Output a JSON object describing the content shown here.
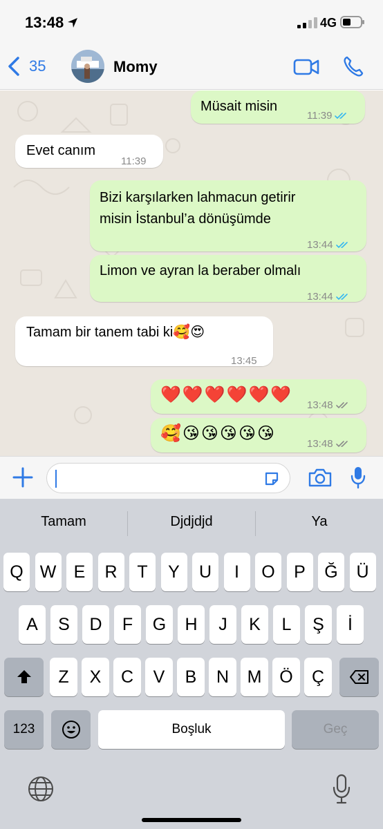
{
  "status_bar": {
    "time": "13:48",
    "network": "4G"
  },
  "header": {
    "back_count": "35",
    "contact_name": "Momy"
  },
  "messages": [
    {
      "direction": "out",
      "text": "Müsait misin",
      "time": "11:39",
      "read": true
    },
    {
      "direction": "in",
      "text": "Evet canım",
      "time": "11:39"
    },
    {
      "direction": "out",
      "text": "Bizi karşılarken lahmacun getirir misin İstanbul’a dönüşümde",
      "line1": "Bizi karşılarken lahmacun getirir",
      "line2": "misin İstanbul’a dönüşümde",
      "time": "13:44",
      "read": true
    },
    {
      "direction": "out",
      "text": "Limon ve ayran la beraber olmalı",
      "time": "13:44",
      "read": true
    },
    {
      "direction": "in",
      "text": "Tamam bir tanem tabi ki🥰😍",
      "time": "13:45"
    },
    {
      "direction": "out",
      "text": "❤️❤️❤️❤️❤️❤️",
      "time": "13:48",
      "read": false
    },
    {
      "direction": "out",
      "text": "🥰😘😘😘😘😘",
      "time": "13:48",
      "read": false
    }
  ],
  "colors": {
    "accent": "#2f7ae5",
    "outgoing_bubble": "#dcf8c6",
    "incoming_bubble": "#ffffff",
    "read_ticks": "#34b7f1",
    "delivered_ticks": "#8a8a8a",
    "chat_background": "#ebe6df"
  },
  "keyboard": {
    "suggestions": [
      "Tamam",
      "Djdjdjd",
      "Ya"
    ],
    "row1": [
      "Q",
      "W",
      "E",
      "R",
      "T",
      "Y",
      "U",
      "I",
      "O",
      "P",
      "Ğ",
      "Ü"
    ],
    "row2": [
      "A",
      "S",
      "D",
      "F",
      "G",
      "H",
      "J",
      "K",
      "L",
      "Ş",
      "İ"
    ],
    "row3": [
      "Z",
      "X",
      "C",
      "V",
      "B",
      "N",
      "M",
      "Ö",
      "Ç"
    ],
    "numbers_label": "123",
    "space_label": "Boşluk",
    "return_label": "Geç"
  },
  "icons": [
    "location-arrow-icon",
    "signal-icon",
    "battery-icon",
    "back-chevron-icon",
    "video-call-icon",
    "phone-icon",
    "plus-icon",
    "sticker-icon",
    "camera-icon",
    "mic-icon",
    "shift-icon",
    "backspace-icon",
    "emoji-icon",
    "globe-icon",
    "dictation-icon"
  ]
}
